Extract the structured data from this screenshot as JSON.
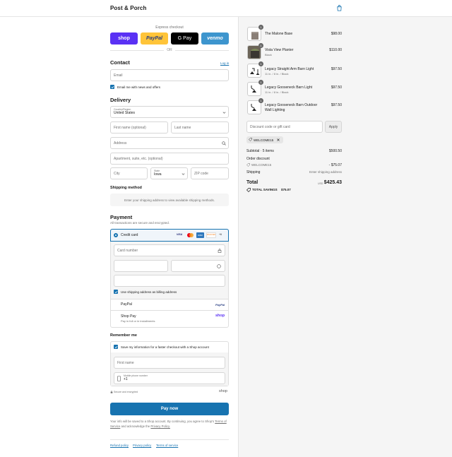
{
  "header": {
    "store_name": "Post & Porch"
  },
  "express": {
    "title": "Express checkout",
    "buttons": [
      "shop",
      "PayPal",
      "G Pay",
      "venmo"
    ],
    "or": "OR"
  },
  "contact": {
    "title": "Contact",
    "login": "Log in",
    "email_placeholder": "Email",
    "news_label": "Email me with news and offers"
  },
  "delivery": {
    "title": "Delivery",
    "country_label": "Country/Region",
    "country_value": "United States",
    "first_name": "First name (optional)",
    "last_name": "Last name",
    "address": "Address",
    "apartment": "Apartment, suite, etc. (optional)",
    "city": "City",
    "state_label": "State",
    "state_value": "Iowa",
    "zip": "ZIP code"
  },
  "shipping": {
    "title": "Shipping method",
    "notice": "Enter your shipping address to view available shipping methods."
  },
  "payment": {
    "title": "Payment",
    "subtitle": "All transactions are secure and encrypted.",
    "credit_card": "Credit card",
    "card_brands": [
      "VISA",
      "MC",
      "AMEX",
      "DISCOVER",
      "+6"
    ],
    "card_number": "Card number",
    "billing_label": "Use shipping address as billing address",
    "paypal": "PayPal",
    "paypal_logo": "PayPal",
    "shop_pay": "Shop Pay",
    "shop_pay_sub": "Pay in full or in installments",
    "shop_logo": "shop"
  },
  "remember": {
    "title": "Remember me",
    "save_label": "Save my information for a faster checkout with a Shop account",
    "first_name": "First name",
    "phone_label": "Mobile phone number",
    "phone_value": "+1",
    "secure": "Secure and encrypted",
    "shop_logo": "shop"
  },
  "pay_now": "Pay now",
  "legal": {
    "part1": "Your info will be saved to a Shop account. By continuing, you agree to Shop's",
    "terms": "Terms of Service",
    "part2": "and acknowledge the",
    "privacy": "Privacy Policy."
  },
  "footer_links": [
    "Refund policy",
    "Privacy policy",
    "Terms of service"
  ],
  "summary": {
    "items": [
      {
        "name": "The Malone Base",
        "sub": "",
        "price": "$98.00",
        "qty": "1"
      },
      {
        "name": "Vista View Planter",
        "sub": "Black",
        "price": "$110.00",
        "qty": "1"
      },
      {
        "name": "Legacy Straight Arm Barn Light",
        "sub": "11 in. / 8 in. / Black",
        "price": "$97.50",
        "qty": "1"
      },
      {
        "name": "Legacy Gooseneck Barn Light",
        "sub": "11 in. / 8 in. / Black",
        "price": "$97.50",
        "qty": "1"
      },
      {
        "name": "Legacy Gooseneck Barn Outdoor Wall Lighting",
        "sub": "",
        "price": "$97.50",
        "qty": "1"
      }
    ],
    "discount_placeholder": "Discount code or gift card",
    "apply": "Apply",
    "code_tag": "WELCOME15",
    "subtotal_label": "Subtotal · 5 items",
    "subtotal_value": "$500.50",
    "order_discount_label": "Order discount",
    "discount_code": "WELCOME15",
    "discount_value": "- $75.07",
    "shipping_label": "Shipping",
    "shipping_value": "Enter shipping address",
    "total_label": "Total",
    "currency": "USD",
    "total_value": "$425.43",
    "savings_label": "TOTAL SAVINGS",
    "savings_value": "$75.07"
  },
  "colors": {
    "accent": "#1773b0",
    "shop": "#5a31f4",
    "paypal": "#ffc439",
    "venmo": "#3d95ce"
  }
}
